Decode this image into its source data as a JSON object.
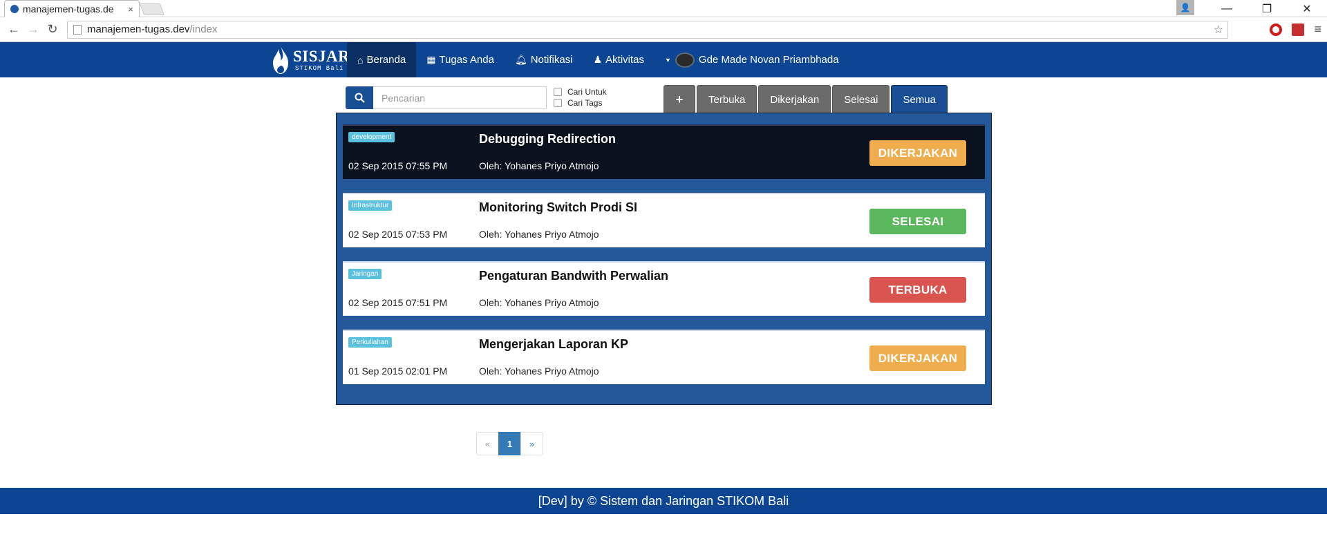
{
  "browser": {
    "tab_title": "manajemen-tugas.de",
    "tab_close": "×",
    "url_host": "manajemen-tugas.dev",
    "url_path": "/index"
  },
  "navbar": {
    "brand_name": "SISJAR",
    "brand_sub": "STIKOM Bali",
    "items": [
      {
        "label": "Beranda",
        "icon": "home-icon"
      },
      {
        "label": "Tugas Anda",
        "icon": "table-icon"
      },
      {
        "label": "Notifikasi",
        "icon": "bell-icon"
      },
      {
        "label": "Aktivitas",
        "icon": "user-icon"
      }
    ],
    "user_name": "Gde Made Novan Priambhada",
    "color": "#0d4592"
  },
  "search": {
    "placeholder": "Pencarian",
    "options": [
      "Cari Untuk",
      "Cari Tags"
    ]
  },
  "filters": {
    "add_label": "+",
    "tabs": [
      "Terbuka",
      "Dikerjakan",
      "Selesai",
      "Semua"
    ],
    "active": "Semua"
  },
  "tasks": [
    {
      "tag": "development",
      "date": "02 Sep 2015 07:55 PM",
      "title": "Debugging Redirection",
      "author": "Oleh: Yohanes Priyo Atmojo",
      "status": "DIKERJAKAN",
      "status_color": "#f0ad4e",
      "highlighted": true
    },
    {
      "tag": "Infrastruktur",
      "date": "02 Sep 2015 07:53 PM",
      "title": "Monitoring Switch Prodi SI",
      "author": "Oleh: Yohanes Priyo Atmojo",
      "status": "SELESAI",
      "status_color": "#5cb85c",
      "highlighted": false
    },
    {
      "tag": "Jaringan",
      "date": "02 Sep 2015 07:51 PM",
      "title": "Pengaturan Bandwith Perwalian",
      "author": "Oleh: Yohanes Priyo Atmojo",
      "status": "TERBUKA",
      "status_color": "#d9534f",
      "highlighted": false
    },
    {
      "tag": "Perkuliahan",
      "date": "01 Sep 2015 02:01 PM",
      "title": "Mengerjakan Laporan KP",
      "author": "Oleh: Yohanes Priyo Atmojo",
      "status": "DIKERJAKAN",
      "status_color": "#f0ad4e",
      "highlighted": false
    }
  ],
  "pagination": {
    "prev": "«",
    "pages": [
      "1"
    ],
    "current": "1",
    "next": "»"
  },
  "footer": {
    "text": "[Dev] by © Sistem dan Jaringan STIKOM Bali"
  }
}
